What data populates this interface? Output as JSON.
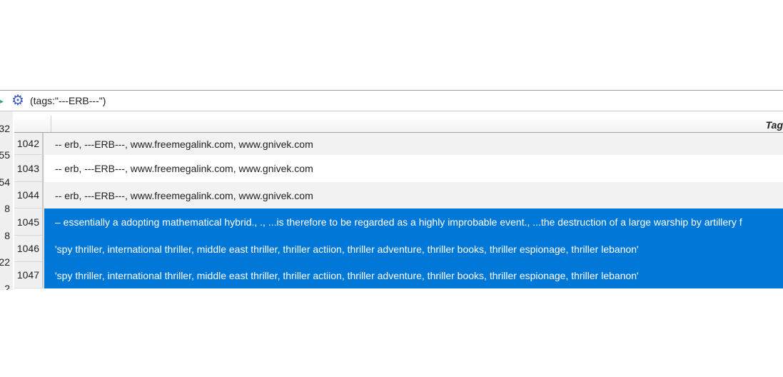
{
  "filter": {
    "query": "(tags:\"---ERB---\")",
    "icon": "gear-icon"
  },
  "left_strip_numbers": [
    "32",
    "55",
    "54",
    "8",
    "8",
    "22",
    "2"
  ],
  "table": {
    "column_header": "Tag",
    "rows": [
      {
        "num": "1042",
        "tags": "-- erb, ---ERB---, www.freemegalink.com, www.gnivek.com",
        "selected": false
      },
      {
        "num": "1043",
        "tags": "-- erb, ---ERB---, www.freemegalink.com, www.gnivek.com",
        "selected": false
      },
      {
        "num": "1044",
        "tags": "-- erb, ---ERB---, www.freemegalink.com, www.gnivek.com",
        "selected": false
      },
      {
        "num": "1045",
        "tags": "– essentially a adopting mathematical hybrid., ., ...is therefore to be regarded as a highly improbable event., ...the destruction of a large warship by artillery f",
        "selected": true
      },
      {
        "num": "1046",
        "tags": "'spy thriller, international thriller, middle east thriller, thriller actiion, thriller adventure, thriller books, thriller espionage, thriller lebanon'",
        "selected": true
      },
      {
        "num": "1047",
        "tags": "'spy thriller, international thriller, middle east thriller, thriller actiion, thriller adventure, thriller books, thriller espionage, thriller lebanon'",
        "selected": true
      }
    ]
  },
  "colors": {
    "selection": "#0078d7",
    "gear": "#3b5fc4"
  }
}
